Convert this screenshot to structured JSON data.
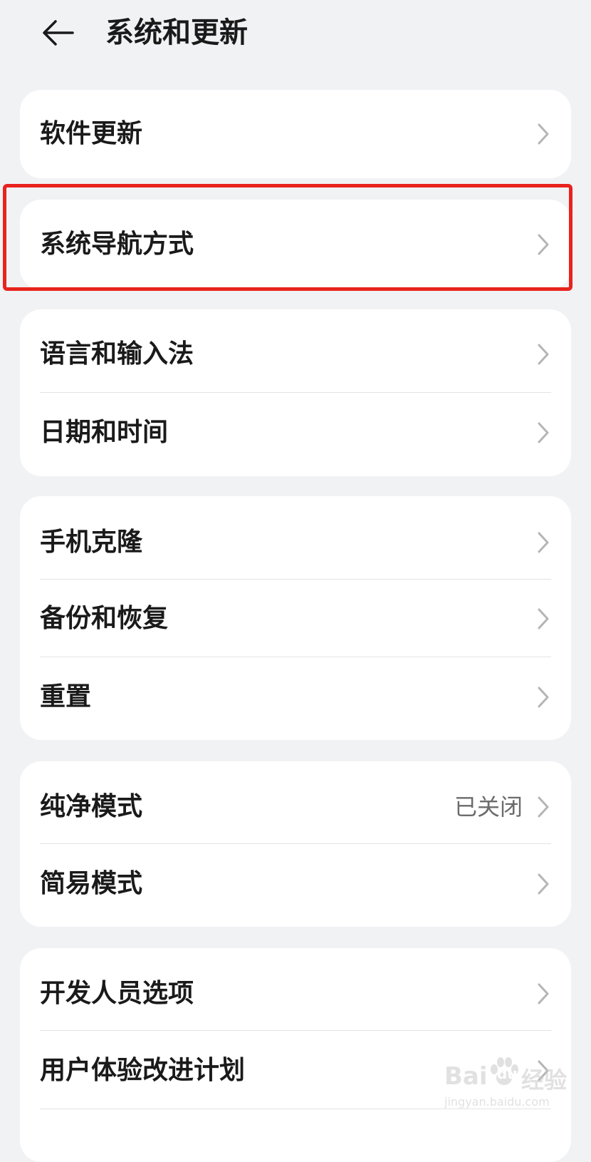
{
  "header": {
    "title": "系统和更新"
  },
  "groups": [
    {
      "items": [
        {
          "label": "软件更新"
        }
      ]
    },
    {
      "items": [
        {
          "label": "系统导航方式"
        }
      ]
    },
    {
      "items": [
        {
          "label": "语言和输入法"
        },
        {
          "label": "日期和时间"
        }
      ]
    },
    {
      "items": [
        {
          "label": "手机克隆"
        },
        {
          "label": "备份和恢复"
        },
        {
          "label": "重置"
        }
      ]
    },
    {
      "items": [
        {
          "label": "纯净模式",
          "value": "已关闭"
        },
        {
          "label": "简易模式"
        }
      ]
    },
    {
      "items": [
        {
          "label": "开发人员选项"
        },
        {
          "label": "用户体验改进计划"
        }
      ]
    }
  ],
  "colors": {
    "background": "#f1f2f4",
    "card": "#ffffff",
    "highlight": "#e8231d"
  },
  "watermark": {
    "brand": "Bai",
    "brand2": "du",
    "suffix": "经验",
    "url": "jingyan.baidu.com"
  }
}
